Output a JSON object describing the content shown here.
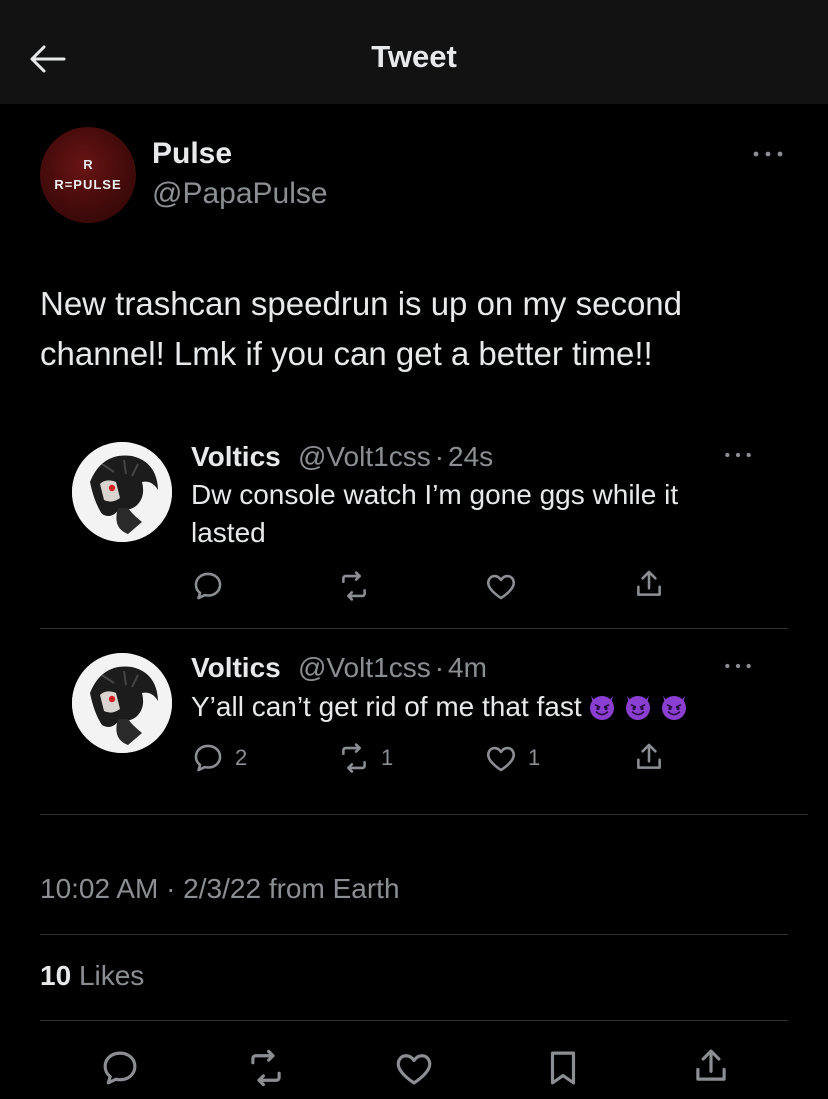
{
  "header": {
    "title": "Tweet",
    "back_icon": "arrow-left-icon"
  },
  "tweet": {
    "author_name": "Pulse",
    "author_handle": "@PapaPulse",
    "avatar_logo_mark": "R",
    "avatar_logo_text": "R=PULSE",
    "text": "New trashcan speedrun is up on my second channel! Lmk if you can get a better time!!",
    "timestamp": "10:02 AM · 2/3/22 from Earth",
    "likes_count": "10",
    "likes_label": "Likes"
  },
  "replies": [
    {
      "name": "Voltics",
      "handle": "@Volt1css",
      "time": "24s",
      "separator": "·",
      "text": "Dw console watch I’m gone ggs while it lasted",
      "reply_count": "",
      "retweet_count": "",
      "like_count": ""
    },
    {
      "name": "Voltics",
      "handle": "@Volt1css",
      "time": "4m",
      "separator": "·",
      "text": "Y’all can’t get rid of me that fast",
      "emojis": [
        "smiling-imp-emoji",
        "smiling-imp-emoji",
        "smiling-imp-emoji"
      ],
      "reply_count": "2",
      "retweet_count": "1",
      "like_count": "1"
    }
  ],
  "icons": {
    "reply": "reply-icon",
    "retweet": "retweet-icon",
    "like": "heart-icon",
    "share": "share-icon",
    "bookmark": "bookmark-icon",
    "more": "more-dots-icon"
  },
  "colors": {
    "background": "#000000",
    "header_bg": "#121212",
    "text_primary": "#e7e9ea",
    "text_secondary": "#8b8f94",
    "divider": "#2f3336",
    "emoji_purple": "#7b2fbf"
  }
}
